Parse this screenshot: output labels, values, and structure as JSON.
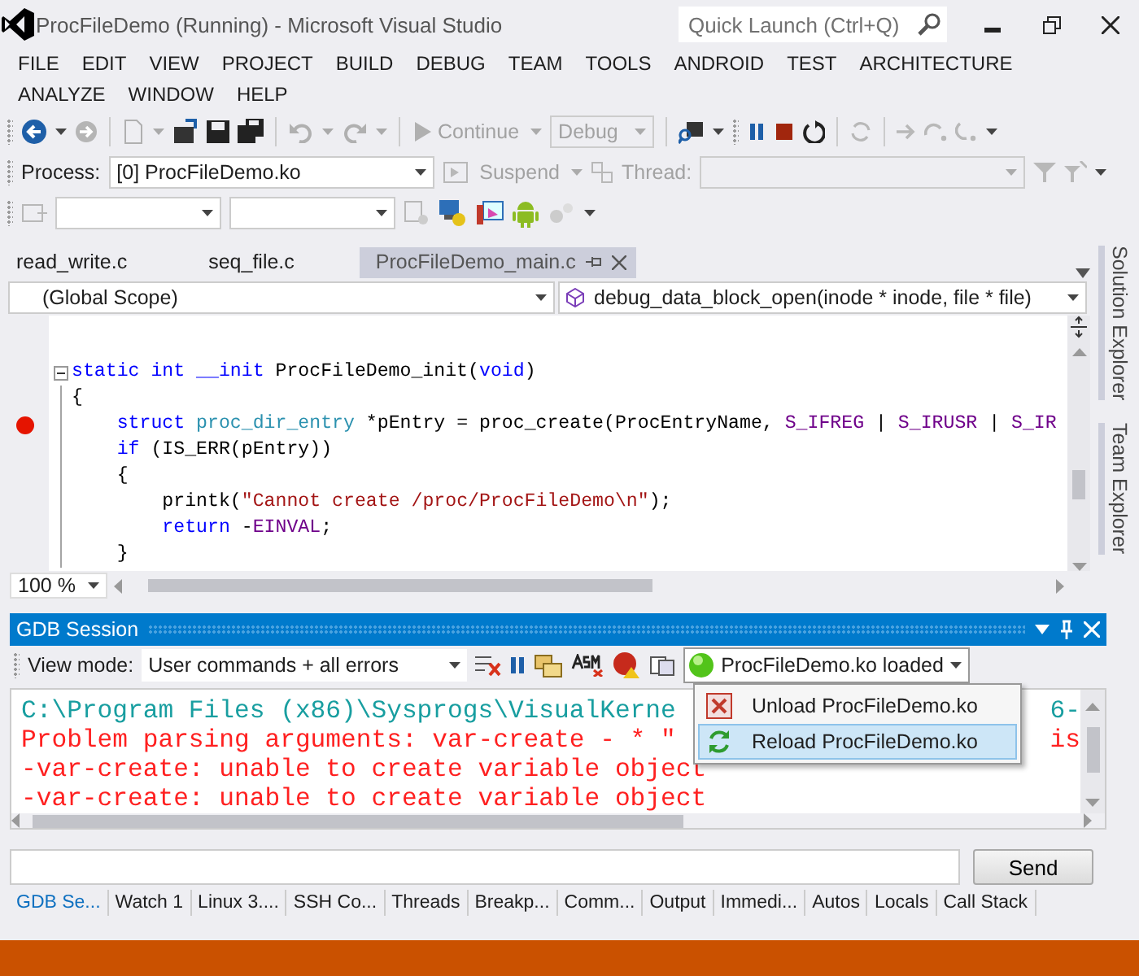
{
  "window": {
    "title": "ProcFileDemo (Running) - Microsoft Visual Studio"
  },
  "quick_launch": {
    "placeholder": "Quick Launch (Ctrl+Q)"
  },
  "menu": [
    "FILE",
    "EDIT",
    "VIEW",
    "PROJECT",
    "BUILD",
    "DEBUG",
    "TEAM",
    "TOOLS",
    "ANDROID",
    "TEST",
    "ARCHITECTURE",
    "ANALYZE",
    "WINDOW",
    "HELP"
  ],
  "toolbar": {
    "continue": {
      "label": "Continue",
      "disabled": true
    },
    "configuration": {
      "value": "Debug",
      "disabled": true
    },
    "process_label": "Process:",
    "process": "[0] ProcFileDemo.ko",
    "suspend": {
      "label": "Suspend",
      "disabled": true
    },
    "thread": {
      "label": "Thread:",
      "disabled": true
    }
  },
  "tabs": [
    {
      "label": "read_write.c",
      "selected": false
    },
    {
      "label": "seq_file.c",
      "selected": false
    },
    {
      "label": "ProcFileDemo_main.c",
      "selected": true
    }
  ],
  "scope": "(Global Scope)",
  "member": "debug_data_block_open(inode * inode, file * file)",
  "code": [
    {
      "breakpoint": false,
      "fold": true,
      "tokens": [
        {
          "text": "static int __init",
          "kind": "keyword"
        },
        {
          "text": " ProcFileDemo_init(",
          "kind": "plain"
        },
        {
          "text": "void",
          "kind": "keyword"
        },
        {
          "text": ")",
          "kind": "plain"
        }
      ]
    },
    {
      "breakpoint": false,
      "fold": false,
      "tokens": [
        {
          "text": "{",
          "kind": "plain"
        }
      ]
    },
    {
      "breakpoint": true,
      "fold": false,
      "tokens": [
        {
          "text": "    struct",
          "kind": "keyword"
        },
        {
          "text": " proc_dir_entry",
          "kind": "type"
        },
        {
          "text": " *pEntry = proc_create(ProcEntryName, ",
          "kind": "plain"
        },
        {
          "text": "S_IFREG",
          "kind": "macro"
        },
        {
          "text": " | ",
          "kind": "plain"
        },
        {
          "text": "S_IRUSR",
          "kind": "macro"
        },
        {
          "text": " | ",
          "kind": "plain"
        },
        {
          "text": "S_IR",
          "kind": "macro"
        }
      ]
    },
    {
      "breakpoint": false,
      "fold": false,
      "tokens": [
        {
          "text": "    if",
          "kind": "keyword"
        },
        {
          "text": " (IS_ERR(pEntry))",
          "kind": "plain"
        }
      ]
    },
    {
      "breakpoint": false,
      "fold": false,
      "tokens": [
        {
          "text": "    {",
          "kind": "plain"
        }
      ]
    },
    {
      "breakpoint": false,
      "fold": false,
      "tokens": [
        {
          "text": "        printk(",
          "kind": "plain"
        },
        {
          "text": "\"Cannot create /proc/ProcFileDemo\\n\"",
          "kind": "string"
        },
        {
          "text": ");",
          "kind": "plain"
        }
      ]
    },
    {
      "breakpoint": false,
      "fold": false,
      "tokens": [
        {
          "text": "        return",
          "kind": "keyword"
        },
        {
          "text": " -",
          "kind": "plain"
        },
        {
          "text": "EINVAL",
          "kind": "macro"
        },
        {
          "text": ";",
          "kind": "plain"
        }
      ]
    },
    {
      "breakpoint": false,
      "fold": false,
      "tokens": [
        {
          "text": "    }",
          "kind": "plain"
        }
      ]
    }
  ],
  "zoom": "100 %",
  "side_tabs": [
    "Solution Explorer",
    "Team Explorer"
  ],
  "gdb": {
    "title": "GDB Session",
    "view_mode_label": "View mode:",
    "view_mode": "User commands + all errors",
    "module_status": "ProcFileDemo.ko loaded",
    "menu": [
      {
        "label": "Unload ProcFileDemo.ko",
        "kind": "unload",
        "selected": false
      },
      {
        "label": "Reload ProcFileDemo.ko",
        "kind": "reload",
        "selected": true
      }
    ],
    "output": [
      {
        "kind": "path",
        "text": "C:\\Program Files (x86)\\Sysprogs\\VisualKerne",
        "tail": "6-"
      },
      {
        "kind": "error",
        "text": "Problem parsing arguments: var-create - * \"",
        "tail": "is"
      },
      {
        "kind": "error",
        "text": "-var-create: unable to create variable object"
      },
      {
        "kind": "error",
        "text": "-var-create: unable to create variable object"
      }
    ],
    "send": "Send"
  },
  "bottom_tabs": [
    {
      "label": "GDB Se...",
      "selected": true
    },
    {
      "label": "Watch 1",
      "selected": false
    },
    {
      "label": "Linux 3....",
      "selected": false
    },
    {
      "label": "SSH Co...",
      "selected": false
    },
    {
      "label": "Threads",
      "selected": false
    },
    {
      "label": "Breakp...",
      "selected": false
    },
    {
      "label": "Comm...",
      "selected": false
    },
    {
      "label": "Output",
      "selected": false
    },
    {
      "label": "Immedi...",
      "selected": false
    },
    {
      "label": "Autos",
      "selected": false
    },
    {
      "label": "Locals",
      "selected": false
    },
    {
      "label": "Call Stack",
      "selected": false
    }
  ]
}
